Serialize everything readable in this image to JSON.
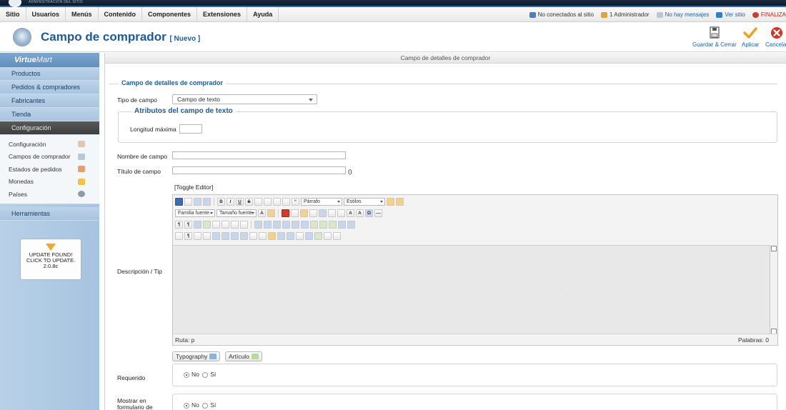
{
  "topbar": {
    "brand": "ADMINISTRACIÓN DEL SITIO"
  },
  "menu": [
    "Sitio",
    "Usuarios",
    "Menús",
    "Contenido",
    "Componentes",
    "Extensiones",
    "Ayuda"
  ],
  "status": {
    "not_connected": "No conectados al sitio",
    "admins": "1 Administrador",
    "messages": "No hay mensajes",
    "view_site": "Ver sitio",
    "logout": "FINALIZA"
  },
  "page": {
    "title": "Campo de comprador",
    "badge": "[ Nuevo ]"
  },
  "toolbar": {
    "save_close": "Guardar & Cerrar",
    "apply": "Aplicar",
    "cancel": "Cancelar"
  },
  "sidebar": {
    "logo_a": "Virtue",
    "logo_b": "Mart",
    "sections": [
      "Productos",
      "Pedidos & compradores",
      "Fabricantes",
      "Tienda",
      "Configuración"
    ],
    "config_items": [
      {
        "label": "Configuración",
        "icon": "tools-icon"
      },
      {
        "label": "Campos de comprador",
        "icon": "form-icon"
      },
      {
        "label": "Estados de pedidos",
        "icon": "status-icon"
      },
      {
        "label": "Monedas",
        "icon": "coins-icon"
      },
      {
        "label": "Países",
        "icon": "globe-icon"
      }
    ],
    "tools": "Herramientas",
    "update": {
      "line1": "UPDATE FOUND!",
      "line2": "CLICK TO UPDATE.",
      "version": "2.0.8c"
    }
  },
  "main": {
    "header": "Campo de detalles de comprador",
    "fieldset_title": "Campo de detalles de comprador",
    "field_type_label": "Tipo de campo",
    "field_type_value": "Campo de texto",
    "text_attrs_title": "Atributos del campo de texto",
    "max_length_label": "Longitud máxima",
    "max_length_value": "",
    "field_name_label": "Nombre de campo",
    "field_name_value": "",
    "field_title_label": "Título de campo",
    "field_title_value": "",
    "field_title_suffix": "()",
    "toggle_editor": "[Toggle Editor]",
    "description_label": "Descripción / Tip",
    "editor": {
      "paragraph": "Párrafo",
      "styles": "Estilos",
      "font_family": "Familia fuente",
      "font_size": "Tamaño fuente",
      "path": "Ruta: p",
      "words": "Palabras: 0"
    },
    "btn_typography": "Typography",
    "btn_article": "Artículo",
    "required_label": "Requerido",
    "show_in_form_label": "Mostrar en formulario de",
    "radio_no": "No",
    "radio_yes": "Sí"
  }
}
